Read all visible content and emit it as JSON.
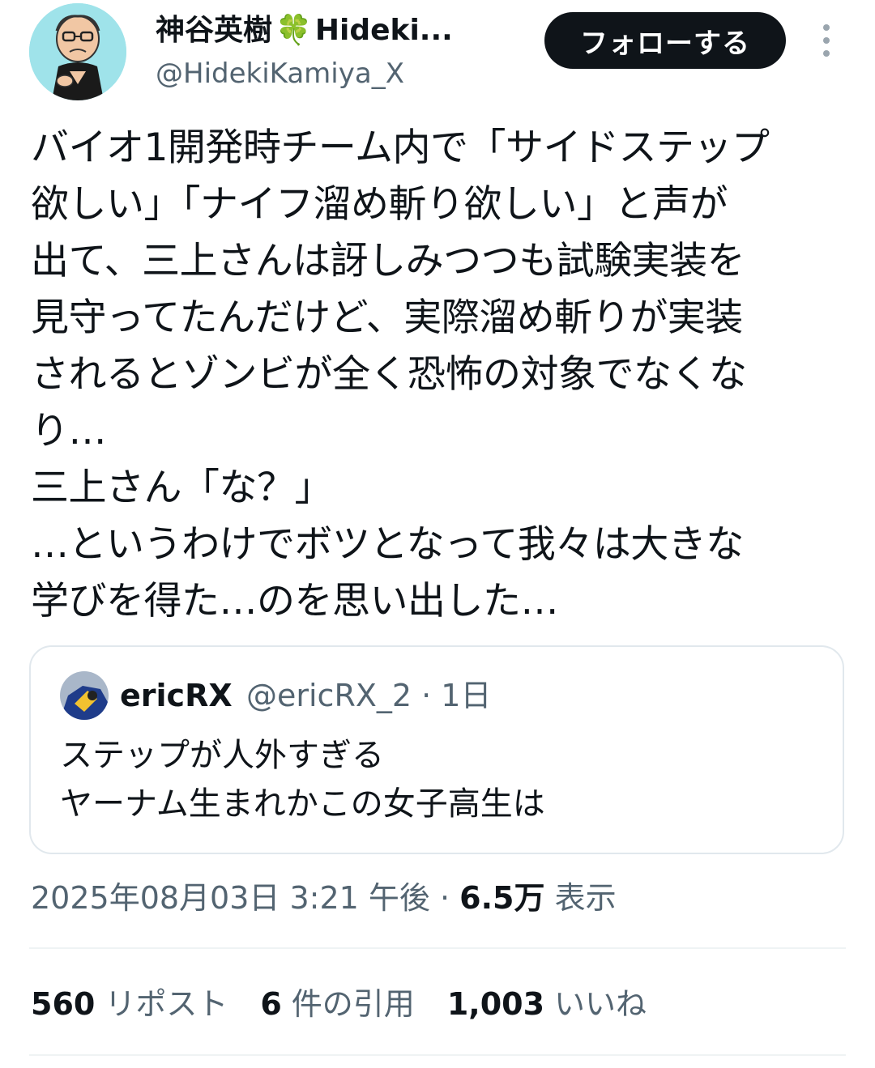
{
  "author": {
    "display_name": "神谷英樹",
    "display_name_emoji": "🍀",
    "display_name_suffix": "Hideki...",
    "handle": "@HidekiKamiya_X"
  },
  "header": {
    "follow_label": "フォローする"
  },
  "tweet": {
    "text": "バイオ1開発時チーム内で「サイドステップ\n欲しい」「ナイフ溜め斬り欲しい」と声が\n出て、三上さんは訝しみつつも試験実装を\n見守ってたんだけど、実際溜め斬りが実装\nされるとゾンビが全く恐怖の対象でなくな\nり…\n三上さん「な？」\n…というわけでボツとなって我々は大きな\n学びを得た…のを思い出した…"
  },
  "quote": {
    "name": "ericRX",
    "meta": "@ericRX_2 · 1日",
    "text": "ステップが人外すぎる\nヤーナム生まれかこの女子高生は"
  },
  "timestamp": {
    "date_time": "2025年08月03日 3:21 午後 ·",
    "views_count": "6.5万",
    "views_label": "表示"
  },
  "stats": {
    "reposts_count": "560",
    "reposts_label": "リポスト",
    "quotes_count": "6",
    "quotes_label": "件の引用",
    "likes_count": "1,003",
    "likes_label": "いいね"
  },
  "colors": {
    "avatar_bg": "#9fe3ea",
    "follow_bg": "#0f1419",
    "secondary_text": "#536471"
  }
}
